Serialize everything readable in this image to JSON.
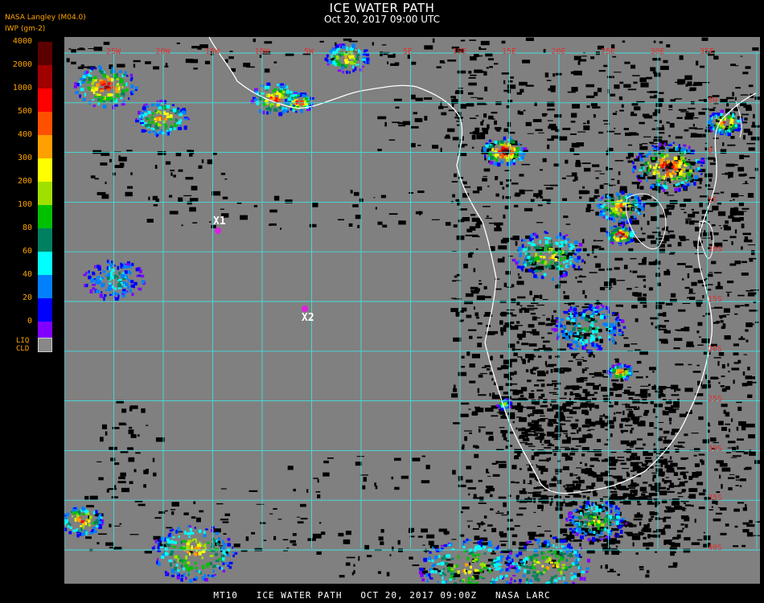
{
  "header": {
    "title": "ICE WATER PATH",
    "subtitle": "Oct 20, 2017 09:00 UTC",
    "source": "NASA Langley (M04.0)",
    "units": "IWP (gm-2)"
  },
  "legend": {
    "items": [
      {
        "label": "4000",
        "color": "#5a0000"
      },
      {
        "label": "2000",
        "color": "#a00000"
      },
      {
        "label": "1000",
        "color": "#ff0000"
      },
      {
        "label": "500",
        "color": "#ff5000"
      },
      {
        "label": "400",
        "color": "#ffa000"
      },
      {
        "label": "300",
        "color": "#ffff00"
      },
      {
        "label": "200",
        "color": "#a0e000"
      },
      {
        "label": "100",
        "color": "#00c000"
      },
      {
        "label": "80",
        "color": "#008060"
      },
      {
        "label": "60",
        "color": "#00ffff"
      },
      {
        "label": "40",
        "color": "#0080ff"
      },
      {
        "label": "20",
        "color": "#0000ff"
      },
      {
        "label": "0",
        "color": "#8000ff"
      }
    ],
    "liq_label_top": "LIQ",
    "liq_label_bottom": "CLD",
    "liq_color": "#888888"
  },
  "map": {
    "lon_labels": [
      "25W",
      "20W",
      "15W",
      "10W",
      "5W",
      "0",
      "5E",
      "10E",
      "15E",
      "20E",
      "25E",
      "30E",
      "35E"
    ],
    "lat_labels": [
      "5N",
      "0",
      "5S",
      "10S",
      "15S",
      "20S",
      "25S",
      "30S",
      "35S",
      "40S"
    ],
    "sites": [
      {
        "label": "X1"
      },
      {
        "label": "X2"
      }
    ],
    "grid_color": "#40e0e0",
    "coast_color": "#ffffff"
  },
  "footer": {
    "text": "MT10   ICE WATER PATH   OCT 20, 2017 09:00Z   NASA LARC"
  }
}
